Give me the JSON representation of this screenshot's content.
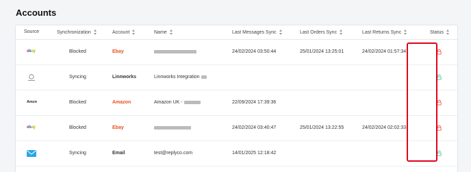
{
  "page": {
    "title": "Accounts"
  },
  "columns": [
    "Source",
    "Synchronization",
    "Account",
    "Name",
    "Last Messages Sync",
    "Last Orders Sync",
    "Last Returns Sync",
    "Status"
  ],
  "rows": [
    {
      "source_icon": "ebay-logo-icon",
      "sync": "Blocked",
      "account": "Ebay",
      "account_color": "#e8501d",
      "name": "",
      "last_messages": "24/02/2024 03:50:44",
      "last_orders": "25/01/2024 13:25:01",
      "last_returns": "24/02/2024 01:57:34",
      "status": "locked",
      "status_color": "#f0533e"
    },
    {
      "source_icon": "linnworks-logo-icon",
      "sync": "Syncing",
      "account": "Linnworks",
      "account_color": "#222222",
      "name": "Linnworks Integration",
      "last_messages": "",
      "last_orders": "",
      "last_returns": "",
      "status": "unlocked",
      "status_color": "#3ec28f"
    },
    {
      "source_icon": "amazon-logo-icon",
      "sync": "Blocked",
      "account": "Amazon",
      "account_color": "#e8501d",
      "name": "Amazon UK -",
      "last_messages": "22/09/2024 17:39:36",
      "last_orders": "",
      "last_returns": "",
      "status": "locked",
      "status_color": "#f0533e"
    },
    {
      "source_icon": "ebay-logo-icon",
      "sync": "Blocked",
      "account": "Ebay",
      "account_color": "#e8501d",
      "name": "",
      "last_messages": "24/02/2024 03:40:47",
      "last_orders": "25/01/2024 13:22:55",
      "last_returns": "24/02/2024 02:02:33",
      "status": "locked",
      "status_color": "#f0533e"
    },
    {
      "source_icon": "email-icon",
      "sync": "Syncing",
      "account": "Email",
      "account_color": "#222222",
      "name": "test@replyco.com",
      "last_messages": "14/01/2025 12:18:42",
      "last_orders": "",
      "last_returns": "",
      "status": "unlocked",
      "status_color": "#3ec28f"
    }
  ],
  "logos": {
    "ebay": [
      "e",
      "b",
      "a",
      "y"
    ],
    "amazon": "Amzn"
  }
}
